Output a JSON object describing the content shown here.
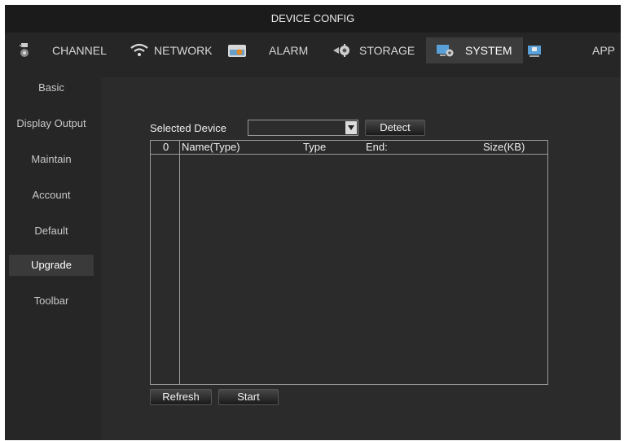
{
  "window": {
    "title": "DEVICE CONFIG"
  },
  "tabs": [
    {
      "label": "CHANNEL",
      "icon": "channel-icon",
      "active": false
    },
    {
      "label": "NETWORK",
      "icon": "wifi-icon",
      "active": false
    },
    {
      "label": "ALARM",
      "icon": "alarm-icon",
      "active": false
    },
    {
      "label": "STORAGE",
      "icon": "storage-gear-icon",
      "active": false
    },
    {
      "label": "SYSTEM",
      "icon": "system-monitor-icon",
      "active": true
    },
    {
      "label": "APP",
      "icon": "app-icon",
      "active": false
    }
  ],
  "sidebar": {
    "items": [
      {
        "label": "Basic"
      },
      {
        "label": "Display Output"
      },
      {
        "label": "Maintain"
      },
      {
        "label": "Account"
      },
      {
        "label": "Default"
      },
      {
        "label": "Upgrade",
        "active": true
      },
      {
        "label": "Toolbar"
      }
    ]
  },
  "upgrade": {
    "selected_device_label": "Selected Device",
    "selected_device_value": "",
    "detect_label": "Detect",
    "columns": [
      "0",
      "Name(Type)",
      "Type",
      "End:",
      "Size(KB)"
    ],
    "rows": [],
    "refresh_label": "Refresh",
    "start_label": "Start"
  },
  "colors": {
    "accent_active": "#3c3c3c",
    "background": "#262626",
    "border": "#9a9a9a"
  }
}
